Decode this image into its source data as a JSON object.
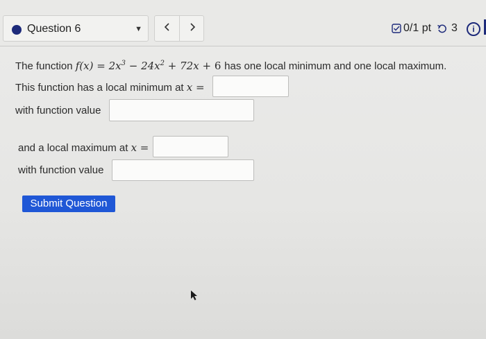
{
  "header": {
    "question_label": "Question 6",
    "score": "0/1 pt",
    "retries": "3",
    "info_symbol": "i"
  },
  "problem": {
    "intro_prefix": "The function",
    "intro_suffix": "has one local minimum and one local maximum.",
    "min_prefix": "This function has a local minimum at",
    "min_var": "x =",
    "func_value_label": "with function value",
    "max_prefix": "and a local maximum at",
    "max_var": "x =",
    "func_value_label_2": "with function value"
  },
  "answers": {
    "min_x": "",
    "min_value": "",
    "max_x": "",
    "max_value": ""
  },
  "submit_label": "Submit Question",
  "colors": {
    "accent": "#1d2a7a",
    "button": "#1f57d6"
  }
}
